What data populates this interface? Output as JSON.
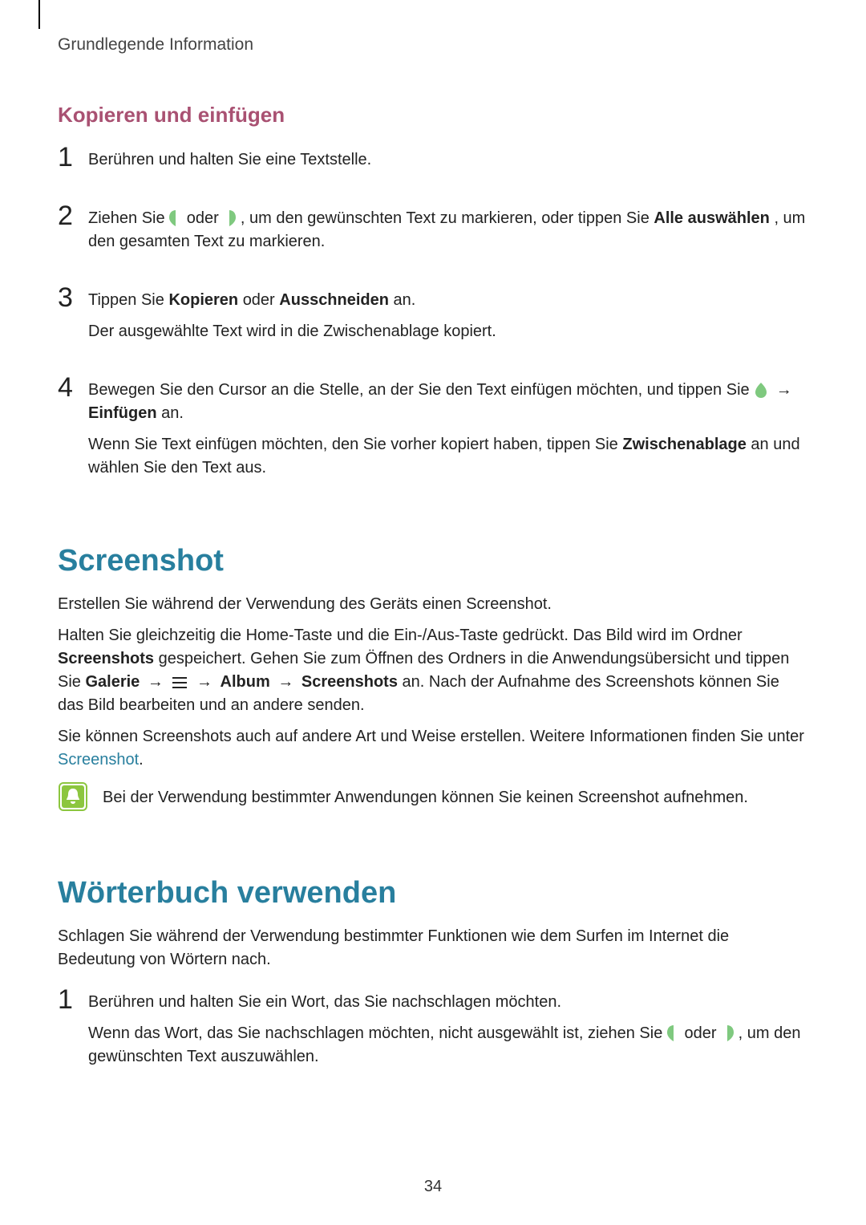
{
  "header": "Grundlegende Information",
  "section1": {
    "title": "Kopieren und einfügen",
    "steps": [
      {
        "num": "1",
        "p1": "Berühren und halten Sie eine Textstelle."
      },
      {
        "num": "2",
        "p1_a": "Ziehen Sie ",
        "p1_b": " oder ",
        "p1_c": ", um den gewünschten Text zu markieren, oder tippen Sie ",
        "p1_bold": "Alle auswählen",
        "p1_d": ", um den gesamten Text zu markieren."
      },
      {
        "num": "3",
        "p1_a": "Tippen Sie ",
        "p1_b1": "Kopieren",
        "p1_c": " oder ",
        "p1_b2": "Ausschneiden",
        "p1_d": " an.",
        "p2": "Der ausgewählte Text wird in die Zwischenablage kopiert."
      },
      {
        "num": "4",
        "p1_a": "Bewegen Sie den Cursor an die Stelle, an der Sie den Text einfügen möchten, und tippen Sie ",
        "p1_b": " → ",
        "p1_bold": "Einfügen",
        "p1_c": " an.",
        "p2_a": "Wenn Sie Text einfügen möchten, den Sie vorher kopiert haben, tippen Sie ",
        "p2_bold": "Zwischenablage",
        "p2_b": " an und wählen Sie den Text aus."
      }
    ]
  },
  "section2": {
    "title": "Screenshot",
    "p1": "Erstellen Sie während der Verwendung des Geräts einen Screenshot.",
    "p2_a": "Halten Sie gleichzeitig die Home-Taste und die Ein-/Aus-Taste gedrückt. Das Bild wird im Ordner ",
    "p2_b1": "Screenshots",
    "p2_b": " gespeichert. Gehen Sie zum Öffnen des Ordners in die Anwendungsübersicht und tippen Sie ",
    "p2_b2": "Galerie",
    "p2_arrow": " → ",
    "p2_b3": "Album",
    "p2_b4": "Screenshots",
    "p2_c": " an. Nach der Aufnahme des Screenshots können Sie das Bild bearbeiten und an andere senden.",
    "p3_a": "Sie können Screenshots auch auf andere Art und Weise erstellen. Weitere Informationen finden Sie unter ",
    "p3_link": "Screenshot",
    "p3_b": ".",
    "note": "Bei der Verwendung bestimmter Anwendungen können Sie keinen Screenshot aufnehmen."
  },
  "section3": {
    "title": "Wörterbuch verwenden",
    "p1": "Schlagen Sie während der Verwendung bestimmter Funktionen wie dem Surfen im Internet die Bedeutung von Wörtern nach.",
    "steps": [
      {
        "num": "1",
        "p1": "Berühren und halten Sie ein Wort, das Sie nachschlagen möchten.",
        "p2_a": "Wenn das Wort, das Sie nachschlagen möchten, nicht ausgewählt ist, ziehen Sie ",
        "p2_b": " oder ",
        "p2_c": ", um den gewünschten Text auszuwählen."
      }
    ]
  },
  "page_number": "34"
}
